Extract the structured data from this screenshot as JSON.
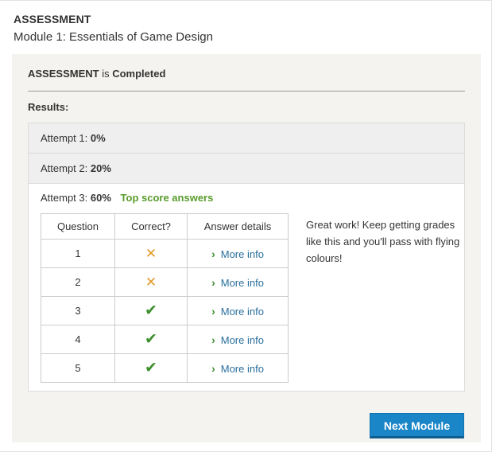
{
  "header": {
    "kicker": "ASSESSMENT",
    "module_title": "Module 1: Essentials of Game Design"
  },
  "status": {
    "name": "ASSESSMENT",
    "connector": "is",
    "state": "Completed"
  },
  "results_label": "Results:",
  "attempts": [
    {
      "label": "Attempt 1:",
      "score": "0%"
    },
    {
      "label": "Attempt 2:",
      "score": "20%"
    },
    {
      "label": "Attempt 3:",
      "score": "60%",
      "badge": "Top score answers"
    }
  ],
  "table": {
    "headers": [
      "Question",
      "Correct?",
      "Answer details"
    ],
    "rows": [
      {
        "question": "1",
        "correct": false,
        "link": "More info"
      },
      {
        "question": "2",
        "correct": false,
        "link": "More info"
      },
      {
        "question": "3",
        "correct": true,
        "link": "More info"
      },
      {
        "question": "4",
        "correct": true,
        "link": "More info"
      },
      {
        "question": "5",
        "correct": true,
        "link": "More info"
      }
    ]
  },
  "feedback": "Great work! Keep getting grades like this and you'll pass with flying colours!",
  "next_button": "Next Module",
  "colors": {
    "accent_blue": "#1a86c8",
    "success_green": "#3e8f2e",
    "error_orange": "#e49a2a",
    "link_blue": "#2a6f9c"
  },
  "icons": {
    "correct": "check-icon",
    "incorrect": "cross-icon",
    "link": "chevron-right-icon"
  }
}
